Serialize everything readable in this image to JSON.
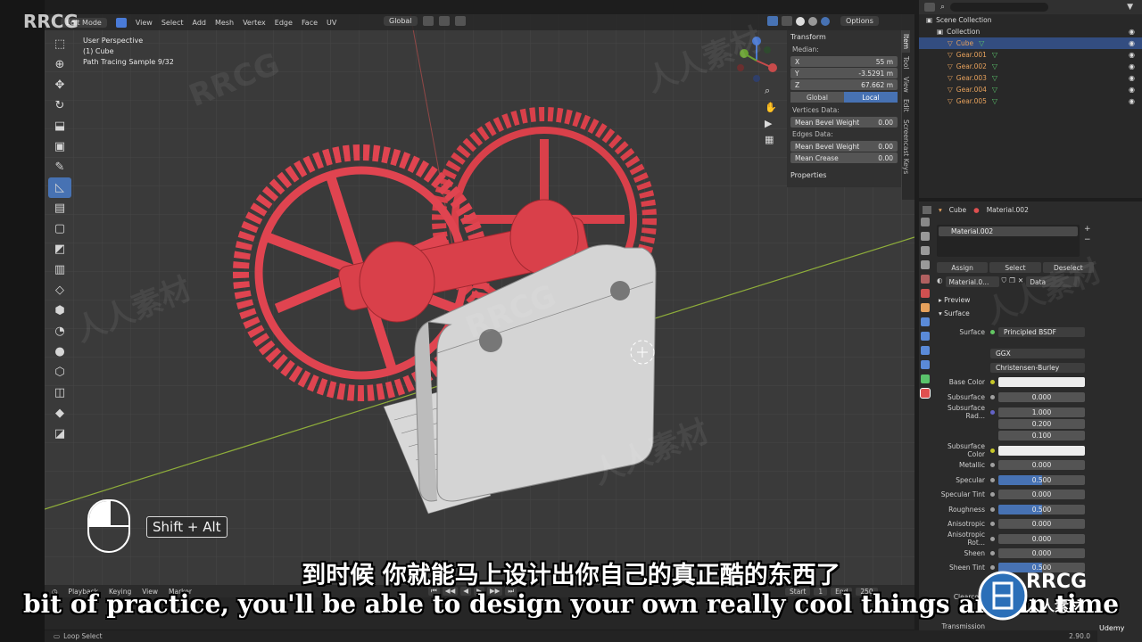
{
  "watermark": {
    "corner": "RRCG",
    "site_mark": "RRCG",
    "cn_mark": "人人素材"
  },
  "viewport_header": {
    "mode": "Edit Mode",
    "menus": [
      "View",
      "Select",
      "Add",
      "Mesh",
      "Vertex",
      "Edge",
      "Face",
      "UV"
    ],
    "orientation": "Global",
    "options": "Options"
  },
  "viewport_info": {
    "view": "User Perspective",
    "object": "(1) Cube",
    "render": "Path Tracing Sample 9/32"
  },
  "toolbar_icons": [
    "select-icon",
    "cursor-icon",
    "move-icon",
    "rotate-icon",
    "scale-icon",
    "transform-icon",
    "annotate-icon",
    "measure-icon",
    "extrude-icon",
    "inset-icon",
    "bevel-icon",
    "loop-cut-icon",
    "knife-icon",
    "poly-build-icon",
    "spin-icon",
    "smooth-icon",
    "edge-slide-icon",
    "shrink-icon",
    "shear-icon",
    "rip-icon"
  ],
  "npanel": {
    "section": "Transform",
    "median_label": "Median:",
    "x_label": "X",
    "x": "55 m",
    "y_label": "Y",
    "y": "-3.5291 m",
    "z_label": "Z",
    "z": "67.662 m",
    "global": "Global",
    "local": "Local",
    "vertices_data": "Vertices Data:",
    "mean_bevel_weight": "Mean Bevel Weight",
    "vertex_bevel_value": "0.00",
    "edges_data": "Edges Data:",
    "edge_bevel_value": "0.00",
    "mean_crease": "Mean Crease",
    "crease_value": "0.00",
    "properties": "Properties",
    "tabs": [
      "Item",
      "Tool",
      "View",
      "Edit",
      "Screencast Keys"
    ]
  },
  "outliner": {
    "rows": [
      {
        "label": "Scene Collection",
        "indent": 0
      },
      {
        "label": "Collection",
        "indent": 1
      },
      {
        "label": "Cube",
        "indent": 2,
        "selected": true
      },
      {
        "label": "Gear.001",
        "indent": 2
      },
      {
        "label": "Gear.002",
        "indent": 2
      },
      {
        "label": "Gear.003",
        "indent": 2
      },
      {
        "label": "Gear.004",
        "indent": 2
      },
      {
        "label": "Gear.005",
        "indent": 2
      }
    ]
  },
  "properties": {
    "object": "Cube",
    "material": "Material.002",
    "slot": "Material.002",
    "assign": "Assign",
    "select": "Select",
    "deselect": "Deselect",
    "mat_field": "Material.0...",
    "link": "Data",
    "preview": "Preview",
    "surface_section": "Surface",
    "surface_label": "Surface",
    "surface_value": "Principled BSDF",
    "distribution": "GGX",
    "subsurface_method": "Christensen-Burley",
    "rows": [
      {
        "label": "Base Color",
        "value": "",
        "color": "white",
        "dot": "y"
      },
      {
        "label": "Subsurface",
        "value": "0.000",
        "dot": ""
      },
      {
        "label": "Subsurface Rad...",
        "value": "1.000",
        "dot": "p"
      },
      {
        "label": "",
        "value": "0.200",
        "dot": "none"
      },
      {
        "label": "",
        "value": "0.100",
        "dot": "none"
      },
      {
        "label": "Subsurface Color",
        "value": "",
        "color": "white",
        "dot": "y"
      },
      {
        "label": "Metallic",
        "value": "0.000",
        "dot": ""
      },
      {
        "label": "Specular",
        "value": "0.500",
        "fill": 0.5,
        "dot": ""
      },
      {
        "label": "Specular Tint",
        "value": "0.000",
        "dot": ""
      },
      {
        "label": "Roughness",
        "value": "0.500",
        "fill": 0.5,
        "dot": ""
      },
      {
        "label": "Anisotropic",
        "value": "0.000",
        "dot": ""
      },
      {
        "label": "Anisotropic Rot...",
        "value": "0.000",
        "dot": ""
      },
      {
        "label": "Sheen",
        "value": "0.000",
        "dot": ""
      },
      {
        "label": "Sheen Tint",
        "value": "0.500",
        "fill": 0.5,
        "dot": ""
      }
    ],
    "partial_labels": [
      "Clearco...",
      "Transmission"
    ]
  },
  "timeline": {
    "playback": "Playback",
    "keying": "Keying",
    "view": "View",
    "marker": "Marker",
    "start_label": "Start",
    "start": "1",
    "end_label": "End",
    "end": "250"
  },
  "status": {
    "action": "Loop Select",
    "version": "2.90.0"
  },
  "shortcut": {
    "keys": "Shift + Alt"
  },
  "subtitles": {
    "cn": "到时候 你就能马上设计出你自己的真正酷的东西了",
    "en": "bit of practice, you'll be able to design your own really cool things and in time"
  },
  "logo": {
    "text": "RRCG",
    "sub": "人人素材",
    "udemy": "Udemy"
  },
  "colors": {
    "accent": "#4772b3",
    "gear": "#d9404a",
    "plate": "#d2d2d2"
  }
}
